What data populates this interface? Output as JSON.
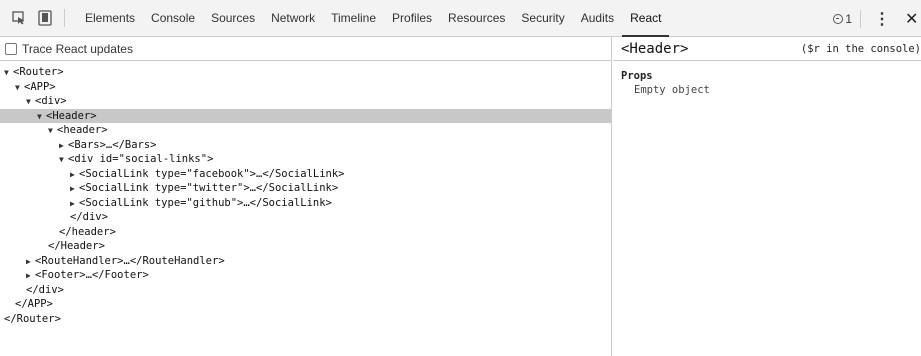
{
  "toolbar": {
    "tabs": [
      {
        "label": "Elements"
      },
      {
        "label": "Console"
      },
      {
        "label": "Sources"
      },
      {
        "label": "Network"
      },
      {
        "label": "Timeline"
      },
      {
        "label": "Profiles"
      },
      {
        "label": "Resources"
      },
      {
        "label": "Security"
      },
      {
        "label": "Audits"
      },
      {
        "label": "React",
        "active": true
      }
    ],
    "error_count": "1",
    "icons": [
      "inspect-icon",
      "device-mode-icon",
      "error-icon",
      "more-icon",
      "close-icon"
    ]
  },
  "left": {
    "trace_label": "Trace React updates",
    "trace_checked": false,
    "tree": [
      {
        "arrow": "▼",
        "text": "<Router>"
      },
      {
        "arrow": "▼",
        "text": "<APP>"
      },
      {
        "arrow": "▼",
        "text": "<div>"
      },
      {
        "arrow": "▼",
        "text": "<Header>",
        "selected": true
      },
      {
        "arrow": "▼",
        "text": "<header>"
      },
      {
        "arrow": "▶",
        "text": "<Bars>…</Bars>"
      },
      {
        "arrow": "▼",
        "text": "<div id=\"social-links\">"
      },
      {
        "arrow": "▶",
        "text": "<SocialLink type=\"facebook\">…</SocialLink>"
      },
      {
        "arrow": "▶",
        "text": "<SocialLink type=\"twitter\">…</SocialLink>"
      },
      {
        "arrow": "▶",
        "text": "<SocialLink type=\"github\">…</SocialLink>"
      },
      {
        "arrow": "",
        "text": "</div>"
      },
      {
        "arrow": "",
        "text": "</header>"
      },
      {
        "arrow": "",
        "text": "</Header>"
      },
      {
        "arrow": "▶",
        "text": "<RouteHandler>…</RouteHandler>"
      },
      {
        "arrow": "▶",
        "text": "<Footer>…</Footer>"
      },
      {
        "arrow": "",
        "text": "</div>"
      },
      {
        "arrow": "",
        "text": "</APP>"
      },
      {
        "arrow": "",
        "text": "</Router>"
      }
    ]
  },
  "right": {
    "component_name": "<Header>",
    "console_hint": "($r in the console)",
    "props_title": "Props",
    "props_empty": "Empty object"
  },
  "colors": {
    "toolbar_bg": "#f3f3f3",
    "selected_row": "#c8c8c8",
    "border": "#cccccc"
  }
}
